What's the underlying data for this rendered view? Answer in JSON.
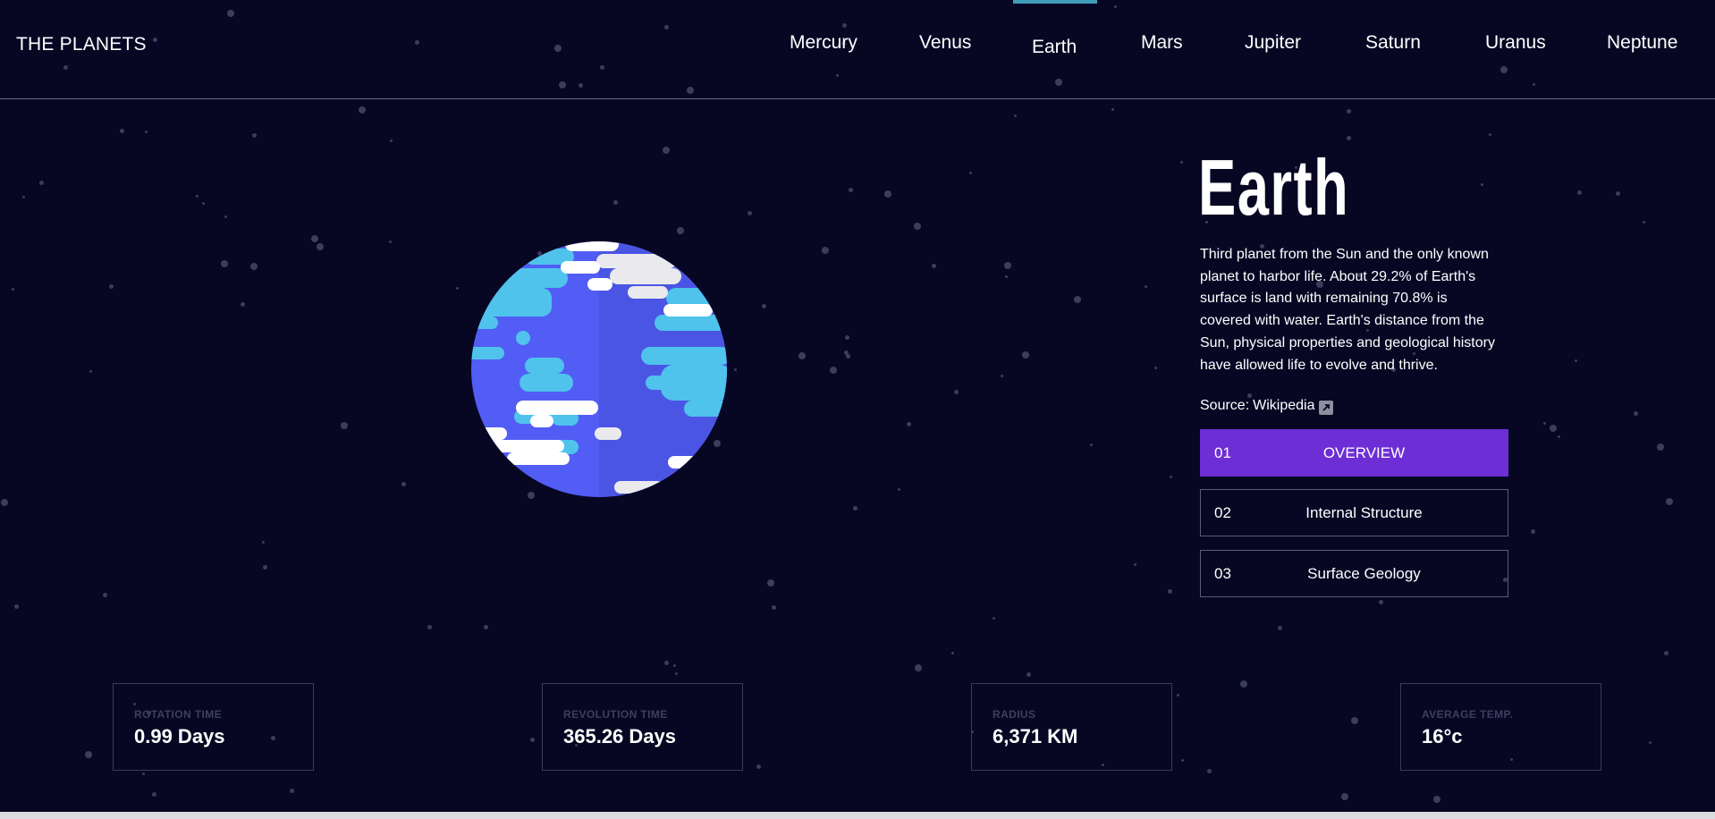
{
  "header": {
    "logo": "THE PLANETS",
    "nav": [
      "Mercury",
      "Venus",
      "Earth",
      "Mars",
      "Jupiter",
      "Saturn",
      "Uranus",
      "Neptune"
    ],
    "active_nav": "Earth",
    "accent_color": "#419ebb"
  },
  "planet": {
    "name": "Earth",
    "description": "Third planet from the Sun and the only known planet to harbor life. About 29.2% of Earth's surface is land with remaining 70.8% is covered with water. Earth's distance from the Sun, physical properties and geological history have allowed life to evolve and thrive.",
    "source_label": "Source:",
    "source_link": "Wikipedia",
    "icon": "external-link-icon"
  },
  "tabs": [
    {
      "num": "01",
      "label": "OVERVIEW",
      "active": true
    },
    {
      "num": "02",
      "label": "Internal Structure",
      "active": false
    },
    {
      "num": "03",
      "label": "Surface Geology",
      "active": false
    }
  ],
  "tab_active_color": "#6d2ed5",
  "stats": [
    {
      "label": "ROTATION TIME",
      "value": "0.99 Days"
    },
    {
      "label": "REVOLUTION TIME",
      "value": "365.26 Days"
    },
    {
      "label": "RADIUS",
      "value": "6,371 KM"
    },
    {
      "label": "AVERAGE TEMP.",
      "value": "16°c"
    }
  ]
}
